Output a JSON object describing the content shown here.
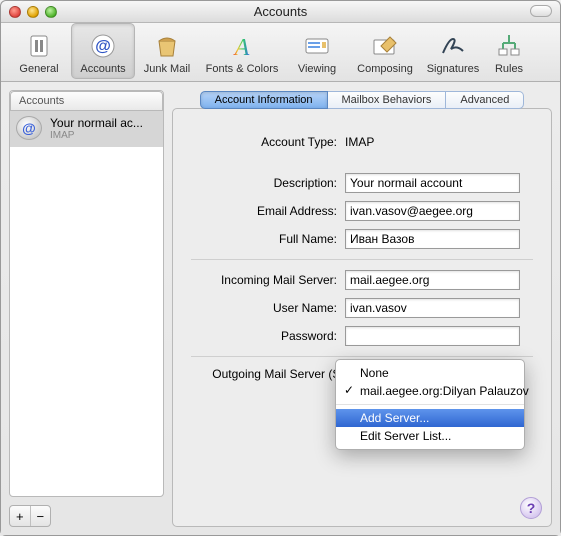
{
  "window": {
    "title": "Accounts"
  },
  "toolbar": {
    "items": [
      {
        "label": "General"
      },
      {
        "label": "Accounts"
      },
      {
        "label": "Junk Mail"
      },
      {
        "label": "Fonts & Colors"
      },
      {
        "label": "Viewing"
      },
      {
        "label": "Composing"
      },
      {
        "label": "Signatures"
      },
      {
        "label": "Rules"
      }
    ],
    "selectedIndex": 1
  },
  "sidebar": {
    "header": "Accounts",
    "accounts": [
      {
        "name": "Your normail ac...",
        "type": "IMAP"
      }
    ],
    "add_label": "+",
    "remove_label": "−"
  },
  "tabs": {
    "items": [
      "Account Information",
      "Mailbox Behaviors",
      "Advanced"
    ],
    "activeIndex": 0
  },
  "form": {
    "account_type_label": "Account Type:",
    "account_type_value": "IMAP",
    "description_label": "Description:",
    "description_value": "Your normail account",
    "email_label": "Email Address:",
    "email_value": "ivan.vasov@aegee.org",
    "fullname_label": "Full Name:",
    "fullname_value": "Иван Вазов",
    "incoming_label": "Incoming Mail Server:",
    "incoming_value": "mail.aegee.org",
    "username_label": "User Name:",
    "username_value": "ivan.vasov",
    "password_label": "Password:",
    "password_value": "",
    "smtp_label": "Outgoing Mail Server (SMTP):"
  },
  "smtp_menu": {
    "items": [
      {
        "label": "None",
        "checked": false
      },
      {
        "label": "mail.aegee.org:Dilyan Palauzov",
        "checked": true
      }
    ],
    "actions": [
      {
        "label": "Add Server...",
        "highlighted": true
      },
      {
        "label": "Edit Server List..."
      }
    ]
  },
  "help_label": "?"
}
